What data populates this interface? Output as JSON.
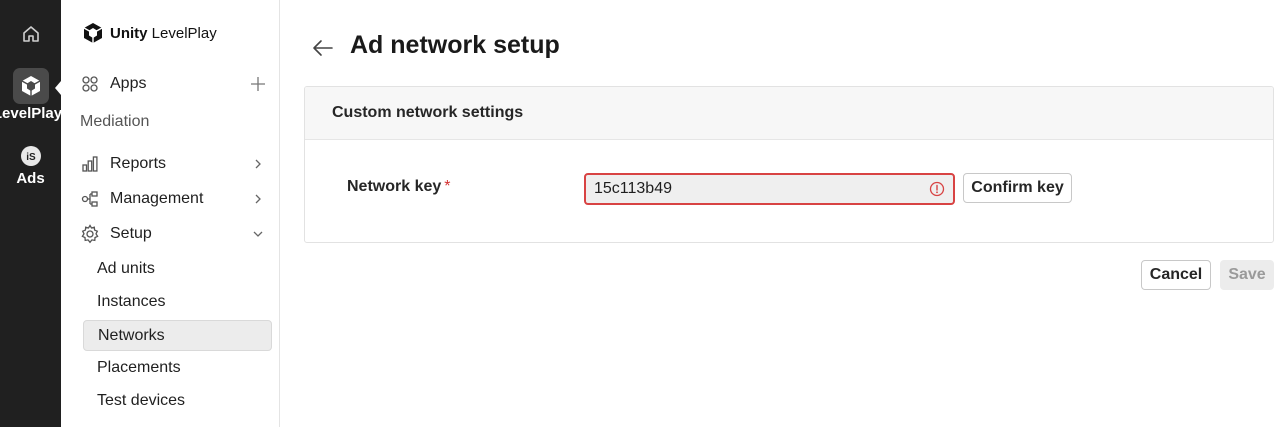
{
  "rail": {
    "home_icon": "home-icon",
    "levelplay_label": "LevelPlay",
    "ads_label": "Ads"
  },
  "sidebar": {
    "brand_bold": "Unity",
    "brand_light": "LevelPlay",
    "apps_label": "Apps",
    "section_mediation": "Mediation",
    "reports_label": "Reports",
    "management_label": "Management",
    "setup_label": "Setup",
    "setup_items": [
      "Ad units",
      "Instances",
      "Networks",
      "Placements",
      "Test devices"
    ],
    "active_item": "Networks"
  },
  "main": {
    "title": "Ad network setup",
    "card_title": "Custom network settings",
    "network_key_label": "Network key",
    "required_mark": "*",
    "network_key_value": "15c113b49",
    "confirm_label": "Confirm key",
    "cancel_label": "Cancel",
    "save_label": "Save"
  },
  "colors": {
    "rail_bg": "#202020",
    "error": "#d84343",
    "active_bg": "#ececec"
  }
}
